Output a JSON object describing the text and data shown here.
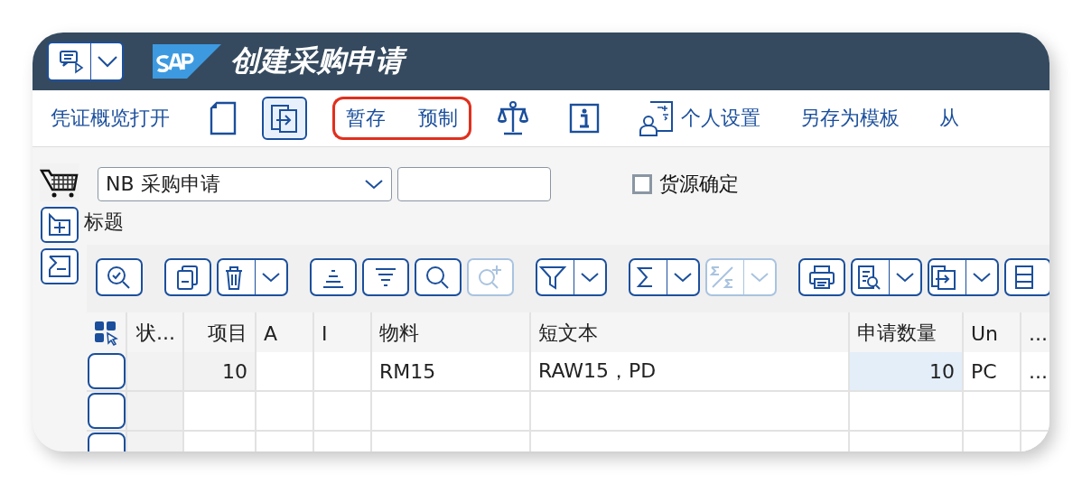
{
  "window": {
    "title": "创建采购申请"
  },
  "toolbar": [
    {
      "kind": "text",
      "label": "凭证概览打开",
      "circled": false
    },
    {
      "kind": "icon",
      "circled": false
    },
    {
      "kind": "icon",
      "circled": false
    },
    {
      "kind": "text",
      "label": "暂存",
      "circled": true
    },
    {
      "kind": "text",
      "label": "预制",
      "circled": true
    },
    {
      "kind": "icon",
      "circled": false
    },
    {
      "kind": "icon",
      "circled": false
    },
    {
      "kind": "icon-text",
      "label": "个人设置",
      "circled": false
    },
    {
      "kind": "text",
      "label": "另存为模板",
      "circled": false
    },
    {
      "kind": "text",
      "label": "从",
      "circled": false
    }
  ],
  "header": {
    "doc_type": {
      "value": "NB  采购申请"
    },
    "source_checkbox": {
      "label": "货源确定",
      "checked": false
    },
    "section_label": "标题"
  },
  "grid_toolbar": [
    {
      "dropdown": false,
      "disabled": false
    },
    {
      "dropdown": false,
      "disabled": false
    },
    {
      "dropdown": true,
      "disabled": false
    },
    {
      "dropdown": false,
      "disabled": false
    },
    {
      "dropdown": false,
      "disabled": false
    },
    {
      "dropdown": false,
      "disabled": false
    },
    {
      "dropdown": false,
      "disabled": true
    },
    {
      "dropdown": true,
      "disabled": false
    },
    {
      "dropdown": true,
      "disabled": false
    },
    {
      "dropdown": true,
      "disabled": true
    },
    {
      "dropdown": false,
      "disabled": false
    },
    {
      "dropdown": true,
      "disabled": false
    },
    {
      "dropdown": true,
      "disabled": false
    },
    {
      "dropdown": false,
      "disabled": false
    }
  ],
  "table": {
    "columns": [
      "状...",
      "项目",
      "A",
      "I",
      "物料",
      "短文本",
      "申请数量",
      "Un",
      "..."
    ],
    "rows": [
      {
        "cells": [
          "",
          "10",
          "",
          "",
          "RM15",
          "RAW15，PD",
          "10",
          "PC",
          "..."
        ]
      },
      {
        "cells": [
          "",
          "",
          "",
          "",
          "",
          "",
          "",
          "",
          ""
        ]
      },
      {
        "cells": [
          "",
          "",
          "",
          "",
          "",
          "",
          "",
          "",
          ""
        ]
      }
    ]
  }
}
